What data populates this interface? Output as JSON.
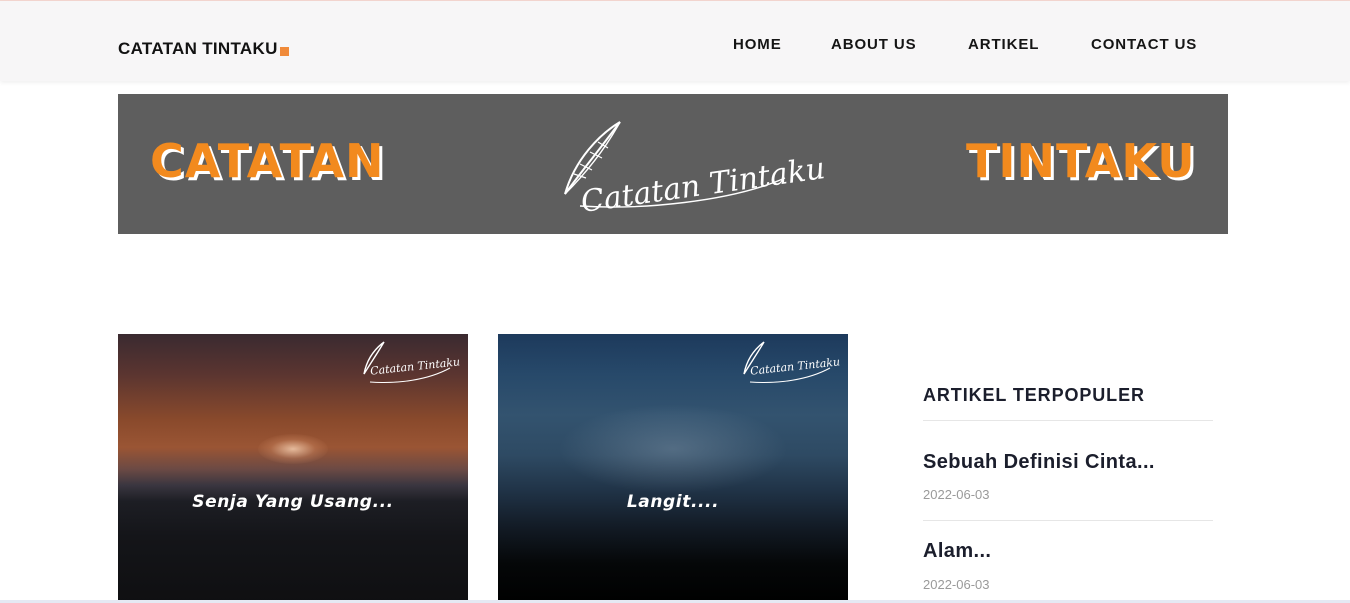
{
  "navbar": {
    "brand": "CATATAN TINTAKU",
    "links": [
      {
        "label": "HOME"
      },
      {
        "label": "ABOUT US"
      },
      {
        "label": "ARTIKEL"
      },
      {
        "label": "CONTACT US"
      }
    ]
  },
  "banner": {
    "left_word": "CATATAN",
    "right_word": "TINTAKU",
    "logo_text": "Catatan Tintaku",
    "background_color": "#5e5e5e",
    "accent_color": "#f28a1e"
  },
  "articles": [
    {
      "title": "Senja Yang Usang...",
      "logo_text": "Catatan Tintaku"
    },
    {
      "title": "Langit....",
      "logo_text": "Catatan Tintaku"
    }
  ],
  "sidebar": {
    "title": "ARTIKEL TERPOPULER",
    "posts": [
      {
        "title": "Sebuah Definisi Cinta...",
        "date": "2022-06-03"
      },
      {
        "title": "Alam...",
        "date": "2022-06-03"
      }
    ]
  }
}
